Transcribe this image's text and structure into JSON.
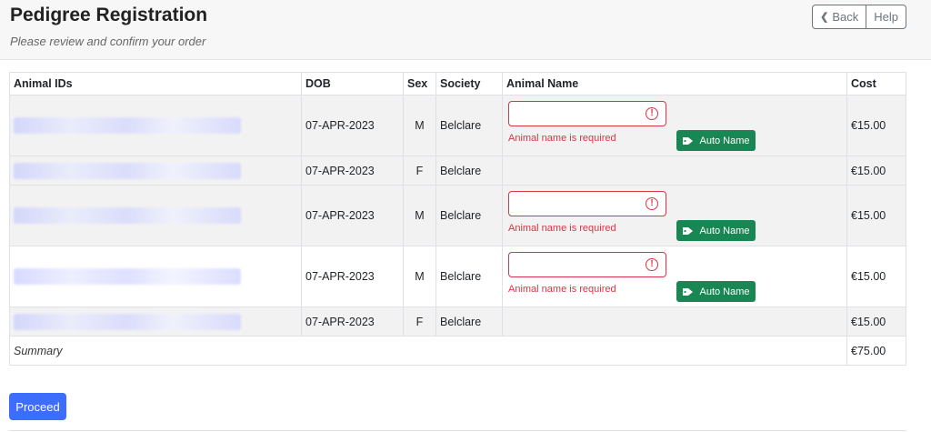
{
  "header": {
    "title": "Pedigree Registration",
    "subtitle": "Please review and confirm your order",
    "back_label": "Back",
    "help_label": "Help"
  },
  "table": {
    "columns": [
      "Animal IDs",
      "DOB",
      "Sex",
      "Society",
      "Animal Name",
      "Cost"
    ],
    "rows": [
      {
        "dob": "07-APR-2023",
        "sex": "M",
        "society": "Belclare",
        "name_required": true,
        "error": "Animal name is required",
        "auto_label": "Auto Name",
        "cost": "€15.00"
      },
      {
        "dob": "07-APR-2023",
        "sex": "F",
        "society": "Belclare",
        "name_required": false,
        "cost": "€15.00"
      },
      {
        "dob": "07-APR-2023",
        "sex": "M",
        "society": "Belclare",
        "name_required": true,
        "error": "Animal name is required",
        "auto_label": "Auto Name",
        "cost": "€15.00"
      },
      {
        "dob": "07-APR-2023",
        "sex": "M",
        "society": "Belclare",
        "name_required": true,
        "error": "Animal name is required",
        "auto_label": "Auto Name",
        "cost": "€15.00"
      },
      {
        "dob": "07-APR-2023",
        "sex": "F",
        "society": "Belclare",
        "name_required": false,
        "cost": "€15.00"
      }
    ],
    "summary_label": "Summary",
    "summary_cost": "€75.00"
  },
  "actions": {
    "proceed_label": "Proceed"
  },
  "colors": {
    "error": "#dc3545",
    "success": "#198754",
    "primary": "#3d6dfd"
  }
}
